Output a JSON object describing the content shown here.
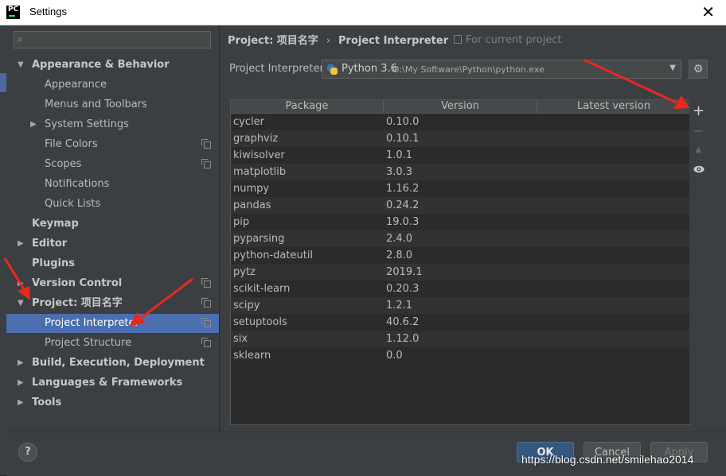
{
  "window": {
    "title": "Settings",
    "app_icon": "PC",
    "close_icon": "✕"
  },
  "sidebar": {
    "search_placeholder": "",
    "items": [
      {
        "label": "Appearance & Behavior",
        "level": 0,
        "expanded": true,
        "bold": true
      },
      {
        "label": "Appearance",
        "level": 1
      },
      {
        "label": "Menus and Toolbars",
        "level": 1
      },
      {
        "label": "System Settings",
        "level": 1,
        "collapsed": true
      },
      {
        "label": "File Colors",
        "level": 1,
        "project_icon": true
      },
      {
        "label": "Scopes",
        "level": 1,
        "project_icon": true
      },
      {
        "label": "Notifications",
        "level": 1
      },
      {
        "label": "Quick Lists",
        "level": 1
      },
      {
        "label": "Keymap",
        "level": 0,
        "bold": true
      },
      {
        "label": "Editor",
        "level": 0,
        "collapsed": true,
        "bold": true
      },
      {
        "label": "Plugins",
        "level": 0,
        "bold": true
      },
      {
        "label": "Version Control",
        "level": 0,
        "collapsed": true,
        "bold": true,
        "project_icon": true
      },
      {
        "label": "Project: 项目名字",
        "level": 0,
        "expanded": true,
        "bold": true,
        "project_icon": true
      },
      {
        "label": "Project Interpreter",
        "level": 1,
        "selected": true,
        "project_icon": true
      },
      {
        "label": "Project Structure",
        "level": 1,
        "project_icon": true
      },
      {
        "label": "Build, Execution, Deployment",
        "level": 0,
        "collapsed": true,
        "bold": true
      },
      {
        "label": "Languages & Frameworks",
        "level": 0,
        "collapsed": true,
        "bold": true
      },
      {
        "label": "Tools",
        "level": 0,
        "collapsed": true,
        "bold": true
      }
    ]
  },
  "main": {
    "breadcrumb": [
      "Project: 项目名字",
      "Project Interpreter"
    ],
    "breadcrumb_sep": "›",
    "for_current_project": "For current project",
    "interpreter_label": "Project Interpreter:",
    "interpreter_name": "Python 3.6",
    "interpreter_path": "D:\\My Software\\Python\\python.exe",
    "table": {
      "headers": [
        "Package",
        "Version",
        "Latest version"
      ],
      "rows": [
        [
          "cycler",
          "0.10.0"
        ],
        [
          "graphviz",
          "0.10.1"
        ],
        [
          "kiwisolver",
          "1.0.1"
        ],
        [
          "matplotlib",
          "3.0.3"
        ],
        [
          "numpy",
          "1.16.2"
        ],
        [
          "pandas",
          "0.24.2"
        ],
        [
          "pip",
          "19.0.3"
        ],
        [
          "pyparsing",
          "2.4.0"
        ],
        [
          "python-dateutil",
          "2.8.0"
        ],
        [
          "pytz",
          "2019.1"
        ],
        [
          "scikit-learn",
          "0.20.3"
        ],
        [
          "scipy",
          "1.2.1"
        ],
        [
          "setuptools",
          "40.6.2"
        ],
        [
          "six",
          "1.12.0"
        ],
        [
          "sklearn",
          "0.0"
        ]
      ]
    },
    "tools": {
      "add": "+",
      "remove": "−",
      "upgrade": "▲",
      "show": "👁"
    }
  },
  "footer": {
    "help": "?",
    "ok": "OK",
    "cancel": "Cancel",
    "apply": "Apply",
    "watermark": "https://blog.csdn.net/smilehao2014"
  },
  "colors": {
    "selected": "#4b6eaf",
    "annotation_arrow": "#e8281e"
  }
}
